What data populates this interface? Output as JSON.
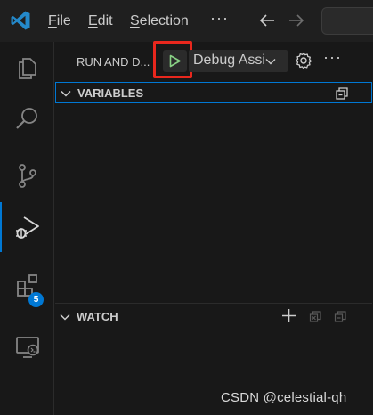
{
  "titlebar": {
    "menu": [
      "File",
      "Edit",
      "Selection"
    ],
    "menu_mnemonics": [
      "F",
      "E",
      "S"
    ],
    "more": "···"
  },
  "activity_bar": {
    "items": [
      {
        "icon": "explorer-icon"
      },
      {
        "icon": "search-icon"
      },
      {
        "icon": "source-control-icon"
      },
      {
        "icon": "run-debug-icon",
        "active": true
      },
      {
        "icon": "extensions-icon",
        "badge": "5"
      },
      {
        "icon": "remote-explorer-icon"
      }
    ]
  },
  "sidebar": {
    "title": "RUN AND D...",
    "config_name": "Debug Assistant",
    "more": "···",
    "sections": {
      "variables": "VARIABLES",
      "watch": "WATCH"
    }
  },
  "watermark": "CSDN @celestial-qh",
  "colors": {
    "accent": "#0078d4",
    "start_green": "#89d185",
    "highlight_red": "#e8271d",
    "background": "#181818"
  }
}
